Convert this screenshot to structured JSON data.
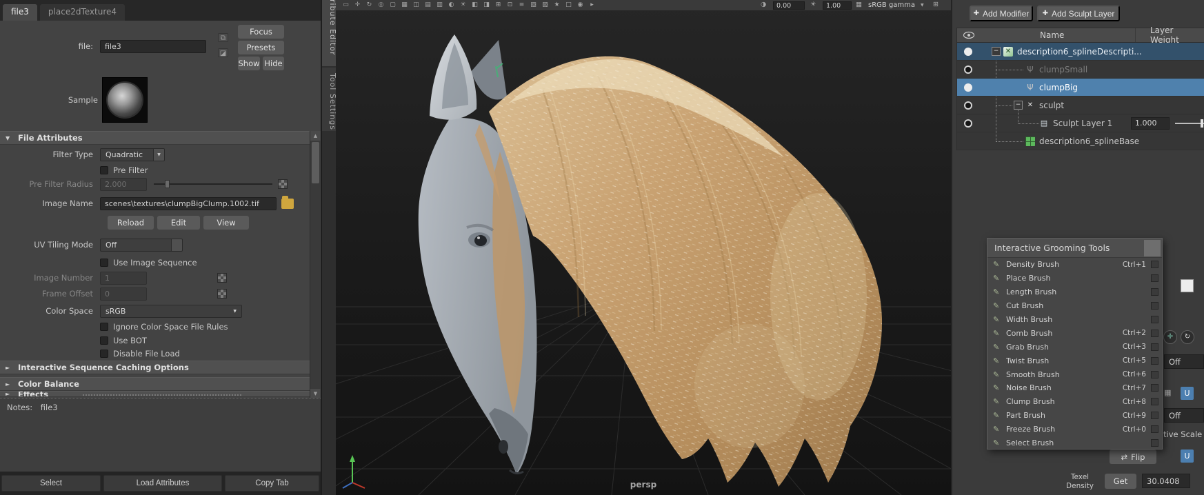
{
  "icons": {
    "plus": "✚",
    "dropdown_arrow": "▼",
    "collapsed_arrow": "►",
    "expanded_arrow": "▼",
    "scroll_up": "▲",
    "scroll_down": "▼",
    "flip": "⇄",
    "pivot": "✛",
    "reset": "↻",
    "comp_top": "⧉",
    "comp_bottom": "◪",
    "brush": "✎",
    "grid": "▦",
    "exposure_icon": "◑",
    "gamma_icon": "☀",
    "view_transform_icon": "▦",
    "toolbar_end_icon": "⊞"
  },
  "attribute_editor": {
    "tabs": [
      {
        "label": "file3",
        "state": "active"
      },
      {
        "label": "place2dTexture4",
        "state": ""
      }
    ],
    "file_field": {
      "label": "file:",
      "value": "file3"
    },
    "header_buttons": {
      "focus": "Focus",
      "presets": "Presets",
      "show": "Show",
      "hide": "Hide"
    },
    "sample_label": "Sample",
    "file_attributes": {
      "title": "File Attributes",
      "filter_type": {
        "label": "Filter Type",
        "value": "Quadratic"
      },
      "pre_filter": {
        "label": "Pre Filter"
      },
      "pre_filter_radius": {
        "label": "Pre Filter Radius",
        "value": "2.000"
      },
      "image_name": {
        "label": "Image Name",
        "value": "scenes\\textures\\clumpBigClump.1002.tif"
      },
      "action_buttons": {
        "reload": "Reload",
        "edit": "Edit",
        "view": "View"
      },
      "uv_tiling_mode": {
        "label": "UV Tiling Mode",
        "value": "Off"
      },
      "use_image_sequence": {
        "label": "Use Image Sequence"
      },
      "image_number": {
        "label": "Image Number",
        "value": "1"
      },
      "frame_offset": {
        "label": "Frame Offset",
        "value": "0"
      },
      "color_space": {
        "label": "Color Space",
        "value": "sRGB"
      },
      "ignore_color_space_rules": {
        "label": "Ignore Color Space File Rules"
      },
      "use_bot": {
        "label": "Use BOT"
      },
      "disable_file_load": {
        "label": "Disable File Load"
      }
    },
    "collapsed_sections": [
      "Interactive Sequence Caching Options",
      "Color Balance",
      "Effects"
    ],
    "notes": {
      "label": "Notes:",
      "value": "file3"
    },
    "footer_buttons": [
      "Select",
      "Load Attributes",
      "Copy Tab"
    ]
  },
  "side_tabs": [
    "Attribute Editor",
    "Tool Settings"
  ],
  "viewport": {
    "toolbar_icons": [
      "▭",
      "✛",
      "↻",
      "◎",
      "▢",
      "▦",
      "◫",
      "▤",
      "▥",
      "◐",
      "☀",
      "◧",
      "◨",
      "⊞",
      "⊡",
      "≡",
      "▧",
      "▨",
      "★",
      "□",
      "◉",
      "▸"
    ],
    "exposure": "0.00",
    "gamma": "1.00",
    "view_transform": "sRGB gamma",
    "camera_label": "persp"
  },
  "right_panel": {
    "add_modifier": "Add Modifier",
    "add_sculpt_layer": "Add Sculpt Layer",
    "name_column": "Name",
    "weight_column": "Layer Weight",
    "layers": [
      {
        "label": "description6_splineDescripti...",
        "glyph": "✕",
        "icon": "desc-icon",
        "state": "selected",
        "indent": "ind-0",
        "expander": "−",
        "toggle": "on",
        "weight": "",
        "weightflag": ""
      },
      {
        "label": "clumpSmall",
        "glyph": "Ψ",
        "icon": "clump-icon",
        "state": "dimmed",
        "indent": "ind-1",
        "expander": "",
        "toggle": "off",
        "weight": "",
        "weightflag": ""
      },
      {
        "label": "clumpBig",
        "glyph": "Ψ",
        "icon": "clump-icon",
        "state": "highlighted",
        "indent": "ind-1",
        "expander": "",
        "toggle": "on",
        "weight": "",
        "weightflag": ""
      },
      {
        "label": "sculpt",
        "glyph": "✕",
        "icon": "sculpt-icon",
        "state": "",
        "indent": "ind-1",
        "expander": "−",
        "toggle": "off",
        "weight": "",
        "weightflag": ""
      },
      {
        "label": "Sculpt Layer 1",
        "glyph": "▤",
        "icon": "layer-icon",
        "state": "",
        "indent": "ind-2",
        "expander": "",
        "toggle": "off",
        "weight": "1.000",
        "weightflag": "has-weight"
      },
      {
        "label": "description6_splineBase",
        "glyph": "",
        "icon": "base-icon",
        "state": "",
        "indent": "ind-1",
        "expander": "",
        "toggle": "none",
        "weight": "",
        "weightflag": ""
      }
    ]
  },
  "grooming_tools": {
    "title": "Interactive Grooming Tools",
    "items": [
      {
        "label": "Density Brush",
        "shortcut": "Ctrl+1"
      },
      {
        "label": "Place Brush",
        "shortcut": ""
      },
      {
        "label": "Length Brush",
        "shortcut": ""
      },
      {
        "label": "Cut Brush",
        "shortcut": ""
      },
      {
        "label": "Width Brush",
        "shortcut": ""
      },
      {
        "label": "Comb Brush",
        "shortcut": "Ctrl+2"
      },
      {
        "label": "Grab Brush",
        "shortcut": "Ctrl+3"
      },
      {
        "label": "Twist Brush",
        "shortcut": "Ctrl+5"
      },
      {
        "label": "Smooth Brush",
        "shortcut": "Ctrl+6"
      },
      {
        "label": "Noise Brush",
        "shortcut": "Ctrl+7"
      },
      {
        "label": "Clump Brush",
        "shortcut": "Ctrl+8"
      },
      {
        "label": "Part Brush",
        "shortcut": "Ctrl+9"
      },
      {
        "label": "Freeze Brush",
        "shortcut": "Ctrl+0"
      },
      {
        "label": "Select Brush",
        "shortcut": ""
      }
    ]
  },
  "tool_settings_fragments": {
    "screen_off": "Off",
    "dist_off": "Off",
    "relative_scale": "ative Scale",
    "flip_label": "Flip",
    "u_button_1": "U",
    "u_button_2": "U",
    "texel_line1": "Texel",
    "texel_line2": "Density",
    "get_label": "Get",
    "texel_value": "30.0408"
  },
  "colors": {
    "highlight": "#5285b5",
    "selected_row": "#33516b",
    "fur": "#c59d6d",
    "face": "#9aa1a8"
  }
}
